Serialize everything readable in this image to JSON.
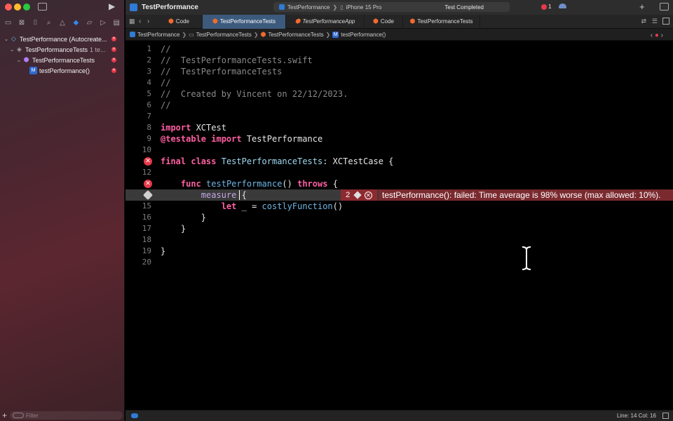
{
  "window": {
    "title": "TestPerformance"
  },
  "sidebar": {
    "tree": [
      {
        "label": "TestPerformance (Autocreate...",
        "detail": ""
      },
      {
        "label": "TestPerformanceTests",
        "detail": "1 te..."
      },
      {
        "label": "TestPerformanceTests",
        "detail": ""
      },
      {
        "label": "testPerformance()",
        "detail": ""
      }
    ],
    "filter_placeholder": "Filter"
  },
  "toolbar": {
    "scheme": "TestPerformance",
    "destination": "iPhone 15 Pro",
    "status": "Test Completed",
    "error_count": "1"
  },
  "tabs": [
    {
      "label": "Code"
    },
    {
      "label": "TestPerformanceTests"
    },
    {
      "label": "TestPerformanceApp"
    },
    {
      "label": "Code"
    },
    {
      "label": "TestPerformanceTests"
    }
  ],
  "breadcrumb": [
    "TestPerformance",
    "TestPerformanceTests",
    "TestPerformanceTests",
    "testPerformance()"
  ],
  "editor": {
    "lines": [
      "//",
      "//  TestPerformanceTests.swift",
      "//  TestPerformanceTests",
      "//",
      "//  Created by Vincent on 22/12/2023.",
      "//",
      "",
      "import XCTest",
      "@testable import TestPerformance",
      "",
      "final class TestPerformanceTests: XCTestCase {",
      "",
      "    func testPerformance() throws {",
      "        measure {",
      "            let _ = costlyFunction()",
      "        }",
      "    }",
      "",
      "}",
      ""
    ],
    "issue_count": "2",
    "issue_message": "testPerformance(): failed: Time average is 98% worse (max allowed: 10%)."
  },
  "statusbar": {
    "position": "Line: 14  Col: 16"
  },
  "colors": {
    "error": "#e7394a",
    "accent": "#3c5a7c"
  }
}
